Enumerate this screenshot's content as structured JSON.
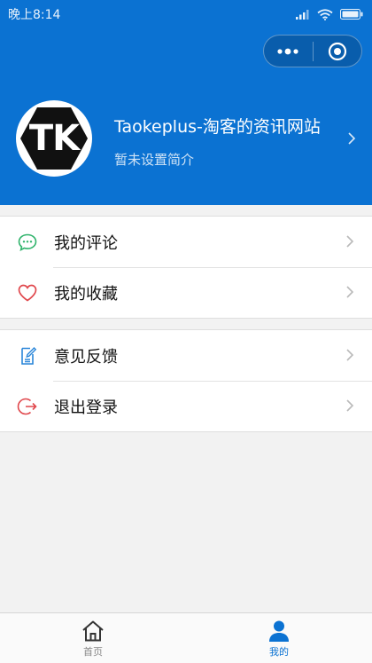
{
  "status_bar": {
    "time": "晚上8:14",
    "signal_icon": "signal-icon",
    "wifi_icon": "wifi-icon",
    "battery_icon": "battery-icon"
  },
  "capsule": {
    "more_icon": "more-dots-icon",
    "close_icon": "target-close-icon"
  },
  "profile": {
    "avatar_text": "TK",
    "name": "Taokeplus-淘客的资讯网站",
    "bio": "暂未设置简介"
  },
  "menu_groups": [
    {
      "items": [
        {
          "label": "我的评论",
          "icon": "comment-icon",
          "color": "#2fb36b"
        },
        {
          "label": "我的收藏",
          "icon": "heart-icon",
          "color": "#e0474c"
        }
      ]
    },
    {
      "items": [
        {
          "label": "意见反馈",
          "icon": "feedback-icon",
          "color": "#2a86d9"
        },
        {
          "label": "退出登录",
          "icon": "logout-icon",
          "color": "#e0474c"
        }
      ]
    }
  ],
  "tabbar": {
    "tabs": [
      {
        "label": "首页",
        "icon": "home-icon",
        "active": false
      },
      {
        "label": "我的",
        "icon": "user-icon",
        "active": true
      }
    ]
  },
  "colors": {
    "primary": "#0b72d2",
    "background": "#f2f2f2",
    "tab_inactive": "#888888"
  }
}
